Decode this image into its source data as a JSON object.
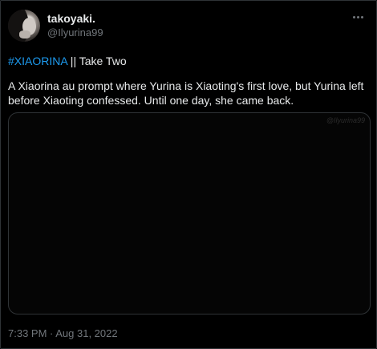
{
  "tweet": {
    "display_name": "takoyaki.",
    "handle": "@Ilyurina99",
    "hashtag": "#XIAORINA",
    "title_rest": " || Take Two",
    "body": "A Xiaorina au prompt where Yurina is Xiaoting's first love, but Yurina left before Xiaoting confessed. Until one day, she came back.",
    "media_watermark": "@Ilyurina99",
    "timestamp": "7:33 PM · Aug 31, 2022"
  },
  "icons": {
    "more": "more-horizontal-icon",
    "avatar": "profile-photo"
  },
  "colors": {
    "background": "#000000",
    "text": "#e7e9ea",
    "secondary": "#71767b",
    "link": "#1d9bf0",
    "border": "#2f3336"
  }
}
